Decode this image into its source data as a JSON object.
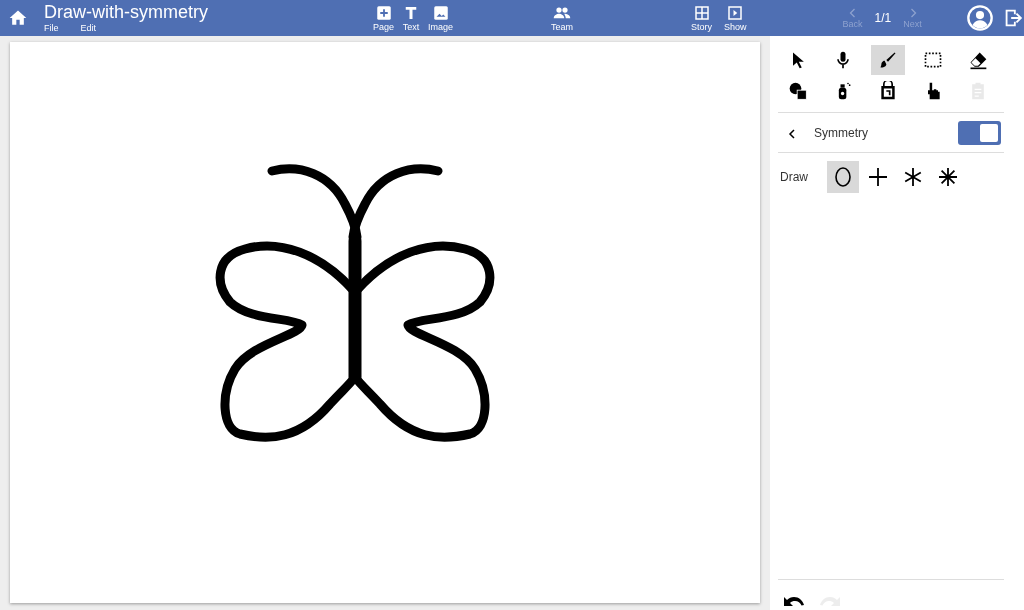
{
  "app": {
    "title": "Draw-with-symmetry",
    "menu": [
      "File",
      "Edit"
    ]
  },
  "toolbar": [
    {
      "kind": "page",
      "label": "Page"
    },
    {
      "kind": "text",
      "label": "Text"
    },
    {
      "kind": "image",
      "label": "Image"
    },
    {
      "kind": "team",
      "label": "Team"
    },
    {
      "kind": "story",
      "label": "Story"
    },
    {
      "kind": "show",
      "label": "Show"
    }
  ],
  "pager": {
    "back": {
      "label": "Back",
      "disabled": true
    },
    "position": "1/1",
    "next": {
      "label": "Next",
      "disabled": true
    }
  },
  "tools": [
    {
      "kind": "pointer",
      "selected": false,
      "disabled": false
    },
    {
      "kind": "mic",
      "selected": false,
      "disabled": false
    },
    {
      "kind": "brush",
      "selected": true,
      "disabled": false
    },
    {
      "kind": "marquee",
      "selected": false,
      "disabled": false
    },
    {
      "kind": "eraser",
      "selected": false,
      "disabled": false
    },
    {
      "kind": "shapes",
      "selected": false,
      "disabled": false
    },
    {
      "kind": "spray",
      "selected": false,
      "disabled": false
    },
    {
      "kind": "bucket",
      "selected": false,
      "disabled": false
    },
    {
      "kind": "hand",
      "selected": false,
      "disabled": false
    },
    {
      "kind": "clipboard",
      "selected": false,
      "disabled": true
    }
  ],
  "panel": {
    "title": "Symmetry",
    "on": true,
    "draw_label": "Draw",
    "modes": [
      {
        "kind": "none",
        "selected": true
      },
      {
        "kind": "cross",
        "selected": false
      },
      {
        "kind": "star6",
        "selected": false
      },
      {
        "kind": "star8",
        "selected": false
      }
    ]
  },
  "history": {
    "undo": {
      "disabled": false
    },
    "redo": {
      "disabled": true
    }
  }
}
